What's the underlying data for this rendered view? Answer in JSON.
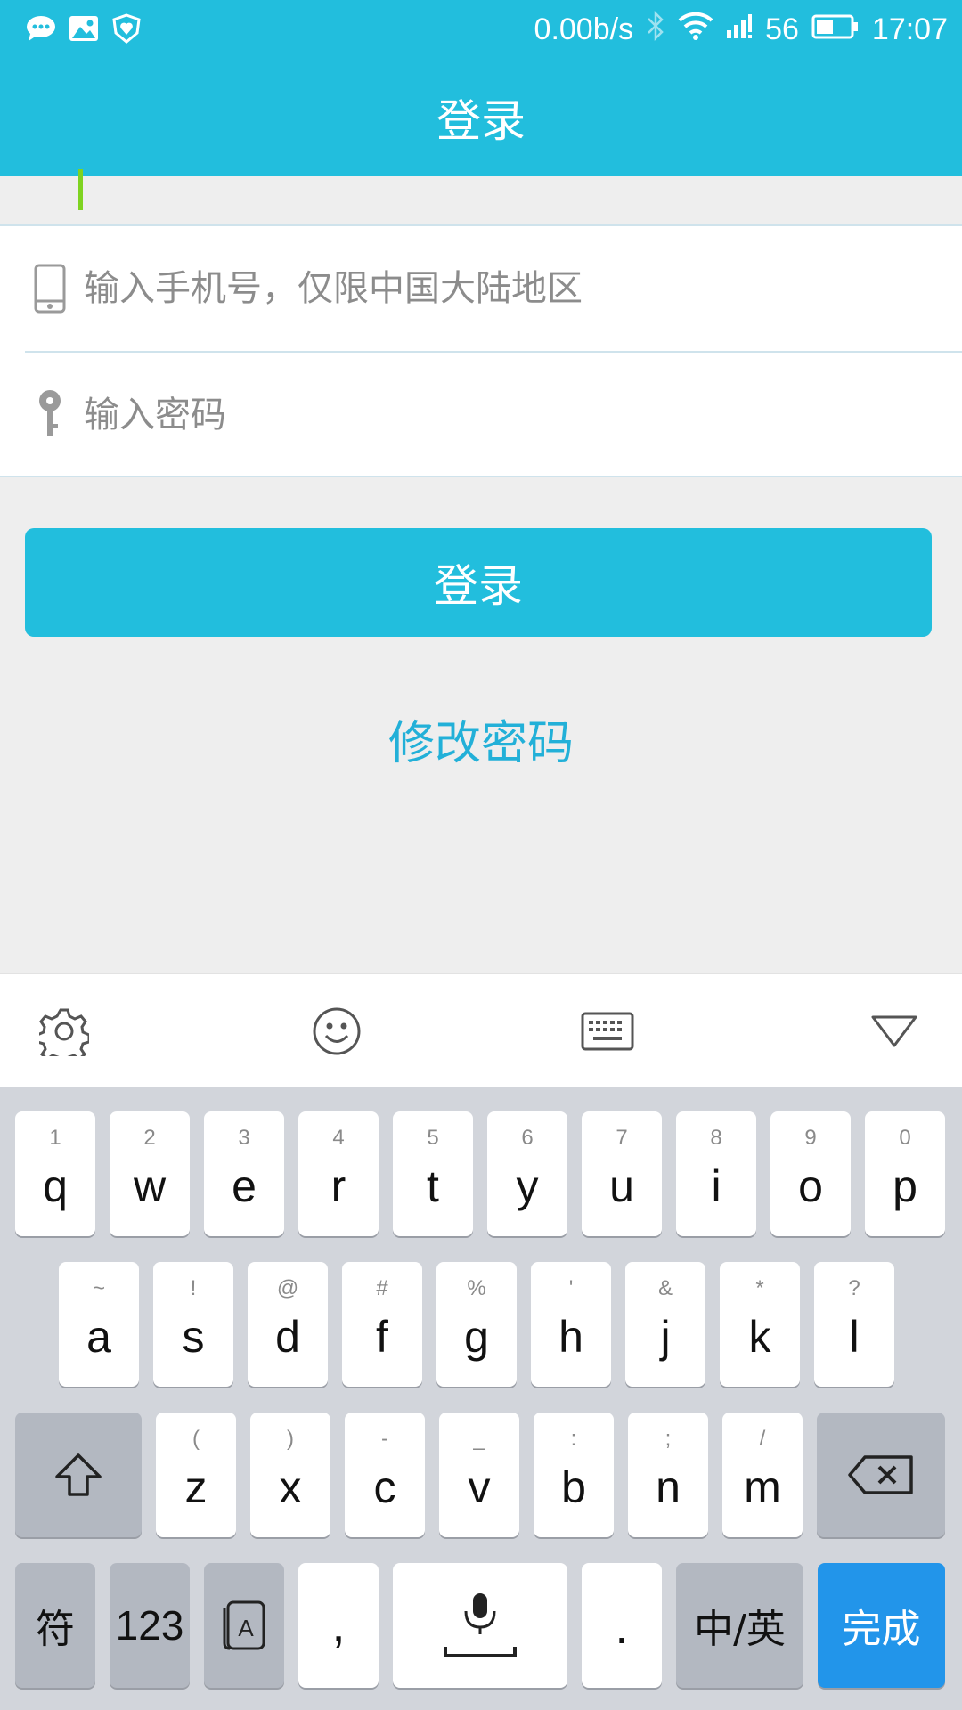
{
  "status_bar": {
    "net_speed": "0.00b/s",
    "signal_label": "56",
    "time": "17:07",
    "left_icons": [
      "chat-bubble-icon",
      "image-icon",
      "shield-heart-icon"
    ]
  },
  "header": {
    "title": "登录"
  },
  "form": {
    "phone_placeholder": "输入手机号，仅限中国大陆地区",
    "password_placeholder": "输入密码"
  },
  "login_button": "登录",
  "change_password_link": "修改密码",
  "keyboard": {
    "toolbar_icons": [
      "gear-icon",
      "smiley-icon",
      "keyboard-icon",
      "collapse-triangle-icon"
    ],
    "row1": [
      {
        "main": "q",
        "sub": "1"
      },
      {
        "main": "w",
        "sub": "2"
      },
      {
        "main": "e",
        "sub": "3"
      },
      {
        "main": "r",
        "sub": "4"
      },
      {
        "main": "t",
        "sub": "5"
      },
      {
        "main": "y",
        "sub": "6"
      },
      {
        "main": "u",
        "sub": "7"
      },
      {
        "main": "i",
        "sub": "8"
      },
      {
        "main": "o",
        "sub": "9"
      },
      {
        "main": "p",
        "sub": "0"
      }
    ],
    "row2": [
      {
        "main": "a",
        "sub": "~"
      },
      {
        "main": "s",
        "sub": "!"
      },
      {
        "main": "d",
        "sub": "@"
      },
      {
        "main": "f",
        "sub": "#"
      },
      {
        "main": "g",
        "sub": "%"
      },
      {
        "main": "h",
        "sub": "'"
      },
      {
        "main": "j",
        "sub": "&"
      },
      {
        "main": "k",
        "sub": "*"
      },
      {
        "main": "l",
        "sub": "?"
      }
    ],
    "row3": [
      {
        "main": "z",
        "sub": "("
      },
      {
        "main": "x",
        "sub": ")"
      },
      {
        "main": "c",
        "sub": "-"
      },
      {
        "main": "v",
        "sub": "_"
      },
      {
        "main": "b",
        "sub": ":"
      },
      {
        "main": "n",
        "sub": ";"
      },
      {
        "main": "m",
        "sub": "/"
      }
    ],
    "symbols_key": "符",
    "numbers_key": "123",
    "comma_key": ",",
    "period_key": ".",
    "lang_key": "中/英",
    "done_key": "完成",
    "done_color": "#2295ea",
    "accent_color": "#22bedd"
  }
}
